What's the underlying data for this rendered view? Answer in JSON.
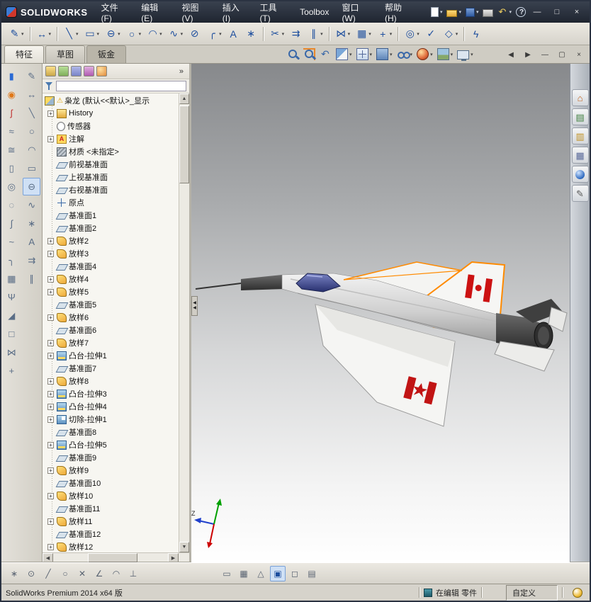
{
  "titlebar": {
    "logo_text": "SOLIDWORKS",
    "menus": [
      {
        "name": "file",
        "label": "文件(F)"
      },
      {
        "name": "edit",
        "label": "编辑(E)"
      },
      {
        "name": "view",
        "label": "视图(V)"
      },
      {
        "name": "insert",
        "label": "插入(I)"
      },
      {
        "name": "tools",
        "label": "工具(T)"
      },
      {
        "name": "toolbox",
        "label": "Toolbox"
      },
      {
        "name": "window",
        "label": "窗口(W)"
      },
      {
        "name": "help",
        "label": "帮助(H)"
      }
    ],
    "quick_access": [
      {
        "name": "new-document",
        "caret": true
      },
      {
        "name": "open-document",
        "caret": true
      },
      {
        "name": "save",
        "caret": true
      },
      {
        "name": "print",
        "caret": false
      },
      {
        "name": "undo",
        "caret": true
      },
      {
        "name": "help",
        "caret": false
      }
    ],
    "window_controls": [
      "minimize",
      "maximize",
      "close"
    ]
  },
  "toolbar": {
    "items": [
      {
        "name": "sketch",
        "caret": true
      },
      {
        "divider": true
      },
      {
        "name": "smart-dimension",
        "caret": true
      },
      {
        "divider": true
      },
      {
        "name": "line",
        "caret": true
      },
      {
        "name": "rectangle",
        "caret": true
      },
      {
        "name": "slot",
        "caret": true
      },
      {
        "name": "circle",
        "caret": true
      },
      {
        "name": "arc",
        "caret": true
      },
      {
        "name": "spline",
        "caret": true
      },
      {
        "name": "ellipse"
      },
      {
        "name": "sketch-fillet",
        "caret": true
      },
      {
        "name": "text"
      },
      {
        "name": "point"
      },
      {
        "divider": true
      },
      {
        "name": "trim-entities",
        "caret": true
      },
      {
        "name": "convert-entities"
      },
      {
        "name": "offset-entities",
        "caret": true
      },
      {
        "divider": true
      },
      {
        "name": "mirror-entities",
        "caret": true
      },
      {
        "name": "linear-pattern",
        "caret": true
      },
      {
        "name": "move-entities",
        "caret": true
      },
      {
        "divider": true
      },
      {
        "name": "display-relations",
        "caret": true
      },
      {
        "name": "repair-sketch"
      },
      {
        "name": "quick-snaps",
        "caret": true
      },
      {
        "divider": true
      },
      {
        "name": "rapid-sketch"
      }
    ]
  },
  "tabs": {
    "items": [
      {
        "name": "features",
        "label": "特征",
        "state": "active"
      },
      {
        "name": "sketch",
        "label": "草图",
        "state": ""
      },
      {
        "name": "sheet-metal",
        "label": "钣金",
        "state": "pressed"
      }
    ]
  },
  "hud": {
    "items": [
      {
        "name": "zoom-fit"
      },
      {
        "name": "zoom-area"
      },
      {
        "name": "previous-view"
      },
      {
        "name": "section-view",
        "caret": true
      },
      {
        "name": "view-orientation",
        "caret": true
      },
      {
        "name": "display-style",
        "caret": true
      },
      {
        "name": "hide-show-items",
        "caret": true
      },
      {
        "name": "edit-appearance",
        "caret": true
      },
      {
        "name": "apply-scene",
        "caret": true
      },
      {
        "name": "view-settings",
        "caret": true
      }
    ]
  },
  "doc_controls": [
    "previous-document",
    "next-document",
    "minimize-document",
    "restore-document",
    "close-document"
  ],
  "left_toolbar": {
    "col_a": [
      "extruded-boss",
      "revolved-boss",
      "swept-boss",
      "lofted-boss",
      "boundary-boss",
      "extruded-cut",
      "hole-wizard",
      "revolved-cut",
      "swept-cut",
      "lofted-cut",
      "fillet",
      "linear-pattern-feature",
      "rib",
      "draft",
      "shell",
      "mirror-feature",
      "reference-geometry"
    ],
    "col_b": [
      "sketch-tool",
      "smart-dimension-tool",
      "line-tool",
      "circle-tool",
      "arc-tool",
      "rectangle-tool",
      "slot-tool",
      "spline-tool",
      "point-tool",
      "text-tool",
      "convert-tool",
      "offset-tool"
    ],
    "col_b_active": 6
  },
  "tree": {
    "panel_tabs": [
      "featuremanager",
      "propertymanager",
      "configurationmanager",
      "dimxpertmanager",
      "displaymanager"
    ],
    "overflow_chevron": "»",
    "filter": {
      "placeholder": ""
    },
    "root": {
      "label": "枭龙 (默认<<默认>_显示",
      "warning": true
    },
    "items": [
      {
        "label": "History",
        "icon": "history",
        "expand": true
      },
      {
        "label": "传感器",
        "icon": "sensors",
        "expand": false
      },
      {
        "label": "注解",
        "icon": "annotations",
        "expand": true
      },
      {
        "label": "材质 <未指定>",
        "icon": "material",
        "expand": false
      },
      {
        "label": "前视基准面",
        "icon": "plane",
        "expand": false
      },
      {
        "label": "上视基准面",
        "icon": "plane",
        "expand": false
      },
      {
        "label": "右视基准面",
        "icon": "plane",
        "expand": false
      },
      {
        "label": "原点",
        "icon": "origin",
        "expand": false
      },
      {
        "label": "基准面1",
        "icon": "plane",
        "expand": false
      },
      {
        "label": "基准面2",
        "icon": "plane",
        "expand": false
      },
      {
        "label": "放样2",
        "icon": "loft",
        "expand": true
      },
      {
        "label": "放样3",
        "icon": "loft",
        "expand": true
      },
      {
        "label": "基准面4",
        "icon": "plane",
        "expand": false
      },
      {
        "label": "放样4",
        "icon": "loft",
        "expand": true
      },
      {
        "label": "放样5",
        "icon": "loft",
        "expand": true
      },
      {
        "label": "基准面5",
        "icon": "plane",
        "expand": false
      },
      {
        "label": "放样6",
        "icon": "loft",
        "expand": true
      },
      {
        "label": "基准面6",
        "icon": "plane",
        "expand": false
      },
      {
        "label": "放样7",
        "icon": "loft",
        "expand": true
      },
      {
        "label": "凸台-拉伸1",
        "icon": "boss",
        "expand": true
      },
      {
        "label": "基准面7",
        "icon": "plane",
        "expand": false
      },
      {
        "label": "放样8",
        "icon": "loft",
        "expand": true
      },
      {
        "label": "凸台-拉伸3",
        "icon": "boss",
        "expand": true
      },
      {
        "label": "凸台-拉伸4",
        "icon": "boss",
        "expand": true
      },
      {
        "label": "切除-拉伸1",
        "icon": "cut",
        "expand": true
      },
      {
        "label": "基准面8",
        "icon": "plane",
        "expand": false
      },
      {
        "label": "凸台-拉伸5",
        "icon": "boss",
        "expand": true
      },
      {
        "label": "基准面9",
        "icon": "plane",
        "expand": false
      },
      {
        "label": "放样9",
        "icon": "loft",
        "expand": true
      },
      {
        "label": "基准面10",
        "icon": "plane",
        "expand": false
      },
      {
        "label": "放样10",
        "icon": "loft",
        "expand": true
      },
      {
        "label": "基准面11",
        "icon": "plane",
        "expand": false
      },
      {
        "label": "放样11",
        "icon": "loft",
        "expand": true
      },
      {
        "label": "基准面12",
        "icon": "plane",
        "expand": false
      },
      {
        "label": "放样12",
        "icon": "loft",
        "expand": true
      }
    ]
  },
  "viewport": {
    "triad_z_label": "Z"
  },
  "task_pane": [
    "solidworks-resources",
    "design-library",
    "file-explorer",
    "view-palette",
    "appearances",
    "custom-properties"
  ],
  "bottom_toolbar": {
    "group1": [
      "snap-points",
      "snap-center",
      "snap-line",
      "snap-quadrant",
      "snap-intersection",
      "snap-angle",
      "snap-arc",
      "snap-perpendicular"
    ],
    "group2": [
      "selection-filter",
      "grid-settings",
      "angle-ruler",
      "shaded-mode",
      "plane-display",
      "design-table"
    ],
    "group2_active": 3
  },
  "statusbar": {
    "left": "SolidWorks Premium 2014 x64 版",
    "editing": "在编辑 零件",
    "custom": "自定义"
  }
}
